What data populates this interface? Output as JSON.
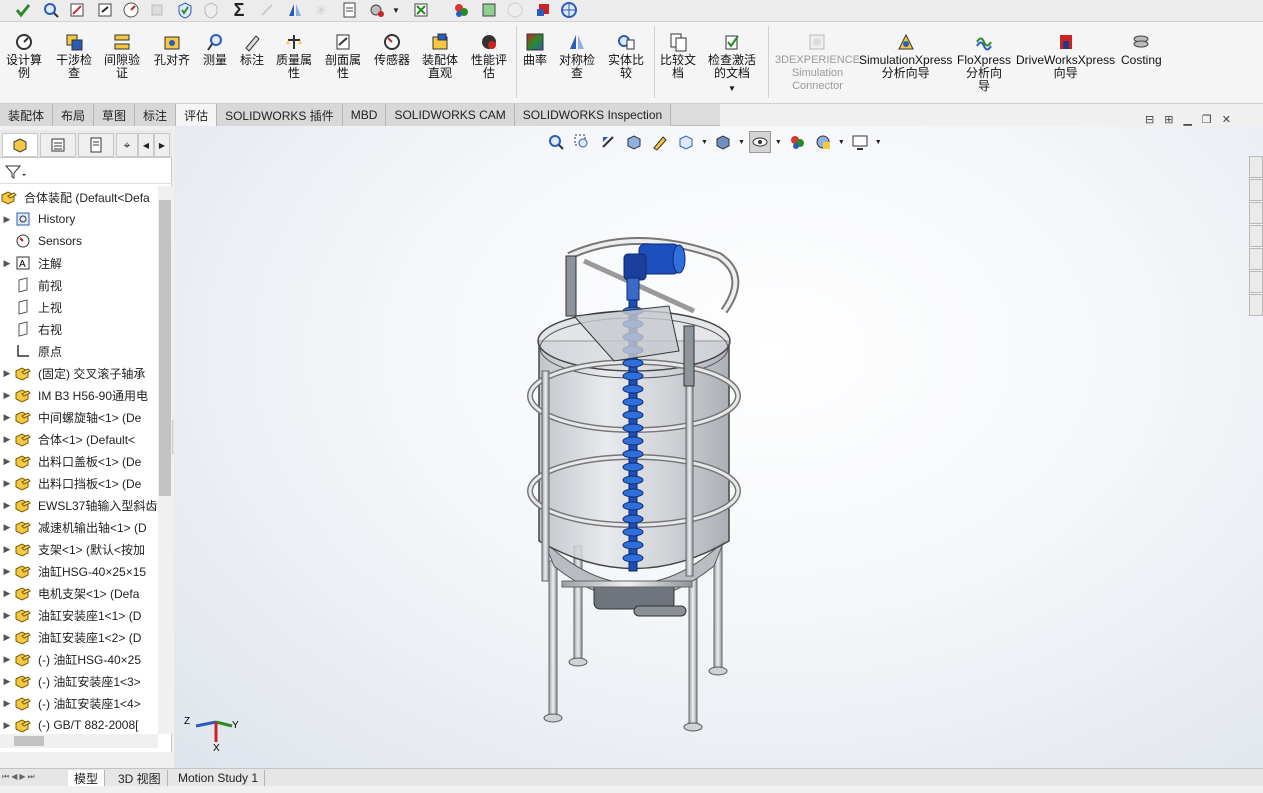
{
  "ribbon": {
    "buttons": [
      {
        "label": "设计算\n例"
      },
      {
        "label": "干涉检\n查"
      },
      {
        "label": "间隙验\n证"
      },
      {
        "label": "孔对齐"
      },
      {
        "label": "测量"
      },
      {
        "label": "标注"
      },
      {
        "label": "质量属\n性"
      },
      {
        "label": "剖面属\n性"
      },
      {
        "label": "传感器"
      },
      {
        "label": "装配体\n直观"
      },
      {
        "label": "性能评\n估"
      },
      {
        "label": "曲率"
      },
      {
        "label": "对称检\n查"
      },
      {
        "label": "实体比\n较"
      },
      {
        "label": "比较文\n档"
      },
      {
        "label": "检查激活\n的文档"
      },
      {
        "label": "3DEXPERIENCE\nSimulation\nConnector"
      },
      {
        "label": "SimulationXpress\n分析向导"
      },
      {
        "label": "FloXpress\n分析向\n导"
      },
      {
        "label": "DriveWorksXpress\n向导"
      },
      {
        "label": "Costing"
      }
    ]
  },
  "command_tabs": [
    "装配体",
    "布局",
    "草图",
    "标注",
    "评估",
    "SOLIDWORKS 插件",
    "MBD",
    "SOLIDWORKS CAM",
    "SOLIDWORKS Inspection"
  ],
  "active_command_tab": "评估",
  "feature_tree": {
    "root": "合体装配  (Default<Defa",
    "items": [
      {
        "label": "History",
        "icon": "history-icon",
        "expandable": true
      },
      {
        "label": "Sensors",
        "icon": "sensors-icon",
        "expandable": false
      },
      {
        "label": "注解",
        "icon": "annotations-icon",
        "expandable": true
      },
      {
        "label": "前视",
        "icon": "plane-icon",
        "expandable": false
      },
      {
        "label": "上视",
        "icon": "plane-icon",
        "expandable": false
      },
      {
        "label": "右视",
        "icon": "plane-icon",
        "expandable": false
      },
      {
        "label": "原点",
        "icon": "origin-icon",
        "expandable": false
      },
      {
        "label": "(固定) 交叉滚子轴承",
        "icon": "part-icon",
        "expandable": true
      },
      {
        "label": "IM B3 H56-90通用电",
        "icon": "part-icon",
        "expandable": true
      },
      {
        "label": "中间螺旋轴<1> (De",
        "icon": "part-icon",
        "expandable": true
      },
      {
        "label": "合体<1> (Default<",
        "icon": "part-icon",
        "expandable": true
      },
      {
        "label": "出料口盖板<1> (De",
        "icon": "part-icon",
        "expandable": true
      },
      {
        "label": "出料口挡板<1> (De",
        "icon": "part-icon",
        "expandable": true
      },
      {
        "label": "EWSL37轴输入型斜齿",
        "icon": "part-icon",
        "expandable": true
      },
      {
        "label": "减速机输出轴<1> (D",
        "icon": "part-icon",
        "expandable": true
      },
      {
        "label": "支架<1> (默认<按加",
        "icon": "part-icon",
        "expandable": true
      },
      {
        "label": "油缸HSG-40×25×15",
        "icon": "part-icon",
        "expandable": true
      },
      {
        "label": "电机支架<1> (Defa",
        "icon": "part-icon",
        "expandable": true
      },
      {
        "label": "油缸安装座1<1> (D",
        "icon": "part-icon",
        "expandable": true
      },
      {
        "label": "油缸安装座1<2> (D",
        "icon": "part-icon",
        "expandable": true
      },
      {
        "label": "(-) 油缸HSG-40×25",
        "icon": "part-icon",
        "expandable": true
      },
      {
        "label": "(-) 油缸安装座1<3>",
        "icon": "part-icon",
        "expandable": true
      },
      {
        "label": "(-) 油缸安装座1<4>",
        "icon": "part-icon",
        "expandable": true
      },
      {
        "label": "(-) GB/T 882-2008[",
        "icon": "part-icon",
        "expandable": true
      }
    ]
  },
  "bottom_tabs": [
    "模型",
    "3D 视图",
    "Motion Study 1"
  ],
  "active_bottom_tab": "模型",
  "triad": {
    "x": "X",
    "y": "Y",
    "z": "Z"
  },
  "colors": {
    "accent_blue": "#1f4fb5",
    "tank_gray": "#b8bcc2",
    "viewport_bg": "#eef1f5"
  }
}
